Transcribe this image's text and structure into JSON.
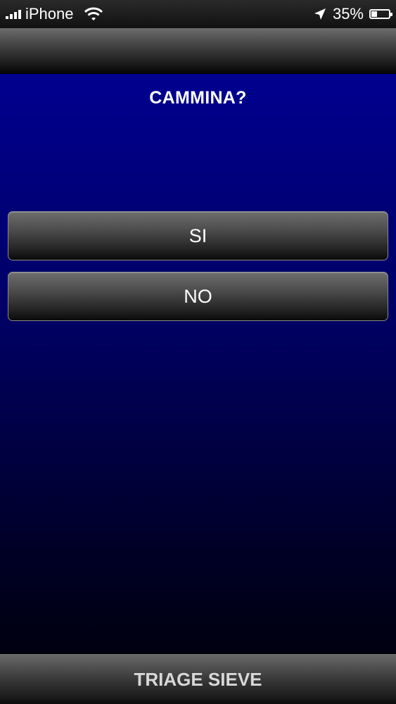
{
  "status_bar": {
    "carrier": "iPhone",
    "battery_percent_text": "35%",
    "battery_level": 0.35,
    "icons": [
      "signal-icon",
      "wifi-icon",
      "location-arrow-icon",
      "battery-icon"
    ]
  },
  "screen": {
    "question": "CAMMINA?",
    "options": [
      {
        "label": "SI"
      },
      {
        "label": "NO"
      }
    ]
  },
  "bottom_bar": {
    "label": "TRIAGE SIEVE"
  },
  "colors": {
    "background_top": "#00008f",
    "background_bottom": "#00000f",
    "button_text": "#ffffff"
  }
}
